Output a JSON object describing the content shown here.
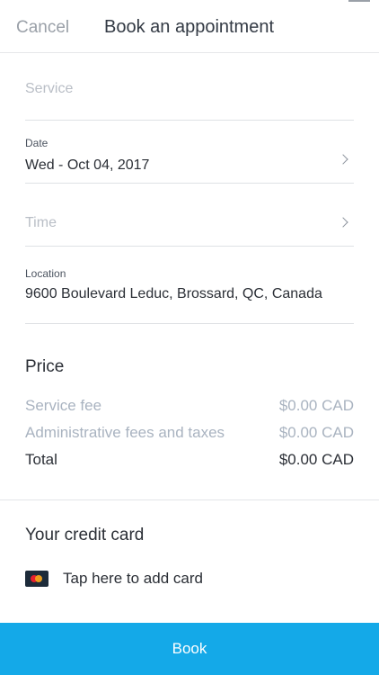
{
  "header": {
    "cancel_label": "Cancel",
    "title": "Book an appointment"
  },
  "form": {
    "service_placeholder": "Service",
    "date_label": "Date",
    "date_value": "Wed - Oct 04, 2017",
    "time_placeholder": "Time",
    "location_label": "Location",
    "location_value": "9600 Boulevard Leduc, Brossard, QC, Canada"
  },
  "price": {
    "title": "Price",
    "rows": [
      {
        "label": "Service fee",
        "value": "$0.00 CAD"
      },
      {
        "label": "Administrative fees and taxes",
        "value": "$0.00 CAD"
      },
      {
        "label": "Total",
        "value": "$0.00 CAD"
      }
    ]
  },
  "card": {
    "title": "Your credit card",
    "add_label": "Tap here to add card"
  },
  "footer": {
    "book_label": "Book"
  },
  "colors": {
    "accent": "#14a9e8",
    "muted_text": "#a9b3c0"
  },
  "icons": {
    "date_chevron": "chevron-right-icon",
    "time_chevron": "chevron-right-icon",
    "card": "mastercard-icon"
  }
}
